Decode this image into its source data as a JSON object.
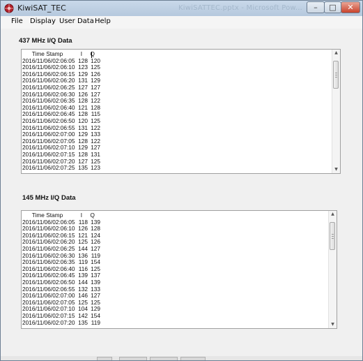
{
  "window": {
    "title": "KiwiSAT_TEC",
    "ghost_title": "KiwiSATTEC.pptx - Microsoft Pow...",
    "controls": {
      "minimize": "–",
      "maximize": "□",
      "close": "✕"
    },
    "icon": "kiwisat-app-icon"
  },
  "menu": {
    "items": [
      {
        "label": "File"
      },
      {
        "label": "Display"
      },
      {
        "label": "User Data"
      },
      {
        "label": "Help"
      }
    ]
  },
  "panel1": {
    "title": "437 MHz I/Q Data",
    "headers": {
      "timestamp": "Time Stamp",
      "i": "I",
      "q": "Q"
    },
    "rows": [
      {
        "ts": "2016/11/06/02:06:05",
        "i": "128",
        "q": "120"
      },
      {
        "ts": "2016/11/06/02:06:10",
        "i": "123",
        "q": "125"
      },
      {
        "ts": "2016/11/06/02:06:15",
        "i": "129",
        "q": "126"
      },
      {
        "ts": "2016/11/06/02:06:20",
        "i": "131",
        "q": "129"
      },
      {
        "ts": "2016/11/06/02:06:25",
        "i": "127",
        "q": "127"
      },
      {
        "ts": "2016/11/06/02:06:30",
        "i": "126",
        "q": "127"
      },
      {
        "ts": "2016/11/06/02:06:35",
        "i": "128",
        "q": "122"
      },
      {
        "ts": "2016/11/06/02:06:40",
        "i": "121",
        "q": "128"
      },
      {
        "ts": "2016/11/06/02:06:45",
        "i": "128",
        "q": "115"
      },
      {
        "ts": "2016/11/06/02:06:50",
        "i": "120",
        "q": "125"
      },
      {
        "ts": "2016/11/06/02:06:55",
        "i": "131",
        "q": "122"
      },
      {
        "ts": "2016/11/06/02:07:00",
        "i": "129",
        "q": "133"
      },
      {
        "ts": "2016/11/06/02:07:05",
        "i": "128",
        "q": "122"
      },
      {
        "ts": "2016/11/06/02:07:10",
        "i": "129",
        "q": "127"
      },
      {
        "ts": "2016/11/06/02:07:15",
        "i": "128",
        "q": "131"
      },
      {
        "ts": "2016/11/06/02:07:20",
        "i": "127",
        "q": "125"
      },
      {
        "ts": "2016/11/06/02:07:25",
        "i": "135",
        "q": "123"
      }
    ]
  },
  "panel2": {
    "title": "145 MHz I/Q Data",
    "headers": {
      "timestamp": "Time Stamp",
      "i": "I",
      "q": "Q"
    },
    "rows": [
      {
        "ts": "2016/11/06/02:06:05",
        "i": "118",
        "q": "139"
      },
      {
        "ts": "2016/11/06/02:06:10",
        "i": "126",
        "q": "128"
      },
      {
        "ts": "2016/11/06/02:06:15",
        "i": "121",
        "q": "124"
      },
      {
        "ts": "2016/11/06/02:06:20",
        "i": "125",
        "q": "126"
      },
      {
        "ts": "2016/11/06/02:06:25",
        "i": "144",
        "q": "127"
      },
      {
        "ts": "2016/11/06/02:06:30",
        "i": "136",
        "q": "119"
      },
      {
        "ts": "2016/11/06/02:06:35",
        "i": "119",
        "q": "154"
      },
      {
        "ts": "2016/11/06/02:06:40",
        "i": "116",
        "q": "125"
      },
      {
        "ts": "2016/11/06/02:06:45",
        "i": "139",
        "q": "137"
      },
      {
        "ts": "2016/11/06/02:06:50",
        "i": "144",
        "q": "139"
      },
      {
        "ts": "2016/11/06/02:06:55",
        "i": "132",
        "q": "133"
      },
      {
        "ts": "2016/11/06/02:07:00",
        "i": "146",
        "q": "127"
      },
      {
        "ts": "2016/11/06/02:07:05",
        "i": "125",
        "q": "125"
      },
      {
        "ts": "2016/11/06/02:07:10",
        "i": "104",
        "q": "129"
      },
      {
        "ts": "2016/11/06/02:07:15",
        "i": "142",
        "q": "154"
      },
      {
        "ts": "2016/11/06/02:07:20",
        "i": "135",
        "q": "119"
      }
    ]
  },
  "scrollbar": {
    "up_arrow": "▲",
    "down_arrow": "▼"
  },
  "colors": {
    "titlebar": "#c9d9ea",
    "close_button": "#c9432c",
    "window_bg": "#f0f0f0",
    "panel_bg": "#ffffff"
  }
}
